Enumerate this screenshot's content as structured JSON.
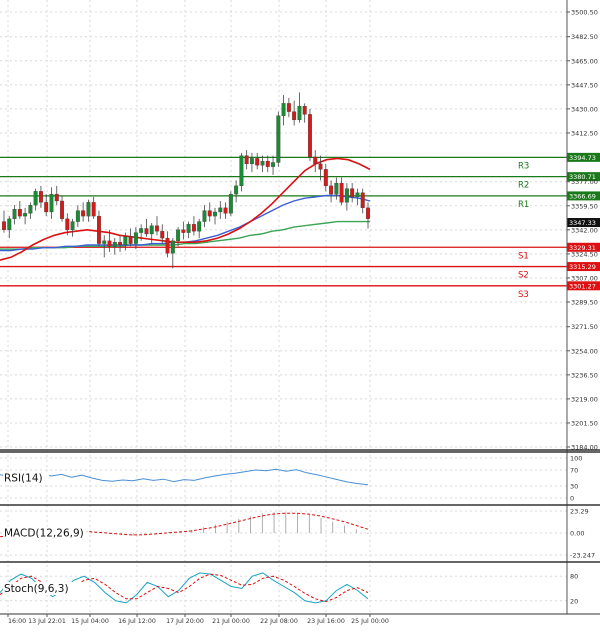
{
  "chart_data": {
    "type": "candlestick",
    "y_axis": {
      "min": 3184.0,
      "max": 3500.5,
      "ticks": [
        "3500.50",
        "3482.50",
        "3465.00",
        "3447.50",
        "3430.00",
        "3412.50",
        "3394.73",
        "3377.00",
        "3359.50",
        "3342.00",
        "3324.50",
        "3307.00",
        "3289.50",
        "3271.50",
        "3254.00",
        "3236.50",
        "3219.00",
        "3201.50",
        "3184.00"
      ]
    },
    "x_axis": {
      "labels": [
        "16:00",
        "13 Jul 22:01",
        "15 Jul 04:00",
        "16 Jul 12:00",
        "17 Jul 20:00",
        "21 Jul 00:00",
        "22 Jul 08:00",
        "23 Jul 16:00",
        "25 Jul 00:00"
      ]
    },
    "levels": [
      {
        "label": "R3",
        "value": 3394.73,
        "value_text": "3394.73",
        "color": "#1a7a1a"
      },
      {
        "label": "R2",
        "value": 3380.71,
        "value_text": "3380.71",
        "color": "#1a7a1a"
      },
      {
        "label": "R1",
        "value": 3366.69,
        "value_text": "3366.69",
        "color": "#1a7a1a"
      },
      {
        "label": "S1",
        "value": 3329.31,
        "value_text": "3329.31",
        "color": "#dd1111"
      },
      {
        "label": "S2",
        "value": 3315.29,
        "value_text": "3315.29",
        "color": "#dd1111"
      },
      {
        "label": "S3",
        "value": 3301.27,
        "value_text": "3301.27",
        "color": "#dd1111"
      }
    ],
    "last_price": {
      "value": 3347.33,
      "value_text": "3347.33"
    },
    "candles": [
      [
        3348,
        3356,
        3340,
        3342
      ],
      [
        3342,
        3352,
        3336,
        3350
      ],
      [
        3350,
        3360,
        3346,
        3357
      ],
      [
        3357,
        3363,
        3350,
        3352
      ],
      [
        3352,
        3358,
        3346,
        3354
      ],
      [
        3354,
        3362,
        3350,
        3360
      ],
      [
        3360,
        3372,
        3356,
        3370
      ],
      [
        3370,
        3374,
        3358,
        3362
      ],
      [
        3362,
        3368,
        3352,
        3355
      ],
      [
        3355,
        3373,
        3350,
        3368
      ],
      [
        3368,
        3374,
        3360,
        3363
      ],
      [
        3363,
        3367,
        3348,
        3350
      ],
      [
        3350,
        3354,
        3338,
        3342
      ],
      [
        3342,
        3350,
        3337,
        3348
      ],
      [
        3348,
        3360,
        3344,
        3356
      ],
      [
        3356,
        3362,
        3348,
        3352
      ],
      [
        3352,
        3364,
        3348,
        3362
      ],
      [
        3362,
        3366,
        3350,
        3352
      ],
      [
        3352,
        3356,
        3330,
        3332
      ],
      [
        3332,
        3338,
        3322,
        3334
      ],
      [
        3334,
        3342,
        3326,
        3330
      ],
      [
        3330,
        3336,
        3324,
        3333
      ],
      [
        3333,
        3338,
        3326,
        3331
      ],
      [
        3331,
        3340,
        3327,
        3337
      ],
      [
        3337,
        3343,
        3330,
        3332
      ],
      [
        3332,
        3344,
        3328,
        3340
      ],
      [
        3340,
        3346,
        3334,
        3343
      ],
      [
        3343,
        3350,
        3337,
        3339
      ],
      [
        3339,
        3347,
        3332,
        3345
      ],
      [
        3345,
        3352,
        3338,
        3341
      ],
      [
        3341,
        3346,
        3332,
        3336
      ],
      [
        3336,
        3341,
        3322,
        3325
      ],
      [
        3325,
        3336,
        3314,
        3334
      ],
      [
        3334,
        3344,
        3330,
        3342
      ],
      [
        3342,
        3348,
        3335,
        3340
      ],
      [
        3340,
        3348,
        3336,
        3346
      ],
      [
        3346,
        3352,
        3338,
        3341
      ],
      [
        3341,
        3350,
        3336,
        3348
      ],
      [
        3348,
        3360,
        3344,
        3356
      ],
      [
        3356,
        3362,
        3348,
        3352
      ],
      [
        3352,
        3358,
        3346,
        3355
      ],
      [
        3355,
        3363,
        3350,
        3358
      ],
      [
        3358,
        3362,
        3350,
        3354
      ],
      [
        3354,
        3370,
        3352,
        3368
      ],
      [
        3368,
        3378,
        3362,
        3374
      ],
      [
        3374,
        3398,
        3370,
        3396
      ],
      [
        3396,
        3400,
        3386,
        3390
      ],
      [
        3390,
        3398,
        3384,
        3394
      ],
      [
        3394,
        3398,
        3386,
        3389
      ],
      [
        3389,
        3396,
        3384,
        3392
      ],
      [
        3392,
        3396,
        3384,
        3388
      ],
      [
        3388,
        3396,
        3382,
        3391
      ],
      [
        3391,
        3428,
        3388,
        3425
      ],
      [
        3425,
        3440,
        3418,
        3434
      ],
      [
        3434,
        3438,
        3424,
        3428
      ],
      [
        3428,
        3436,
        3418,
        3422
      ],
      [
        3422,
        3442,
        3420,
        3432
      ],
      [
        3432,
        3434,
        3420,
        3426
      ],
      [
        3426,
        3430,
        3392,
        3395
      ],
      [
        3395,
        3400,
        3384,
        3390
      ],
      [
        3390,
        3396,
        3378,
        3386
      ],
      [
        3386,
        3390,
        3370,
        3374
      ],
      [
        3374,
        3378,
        3362,
        3368
      ],
      [
        3368,
        3380,
        3364,
        3376
      ],
      [
        3376,
        3380,
        3360,
        3362
      ],
      [
        3362,
        3376,
        3356,
        3372
      ],
      [
        3372,
        3376,
        3362,
        3366
      ],
      [
        3366,
        3372,
        3360,
        3369
      ],
      [
        3369,
        3372,
        3354,
        3358
      ],
      [
        3358,
        3362,
        3343,
        3350
      ]
    ],
    "ma": {
      "red": [
        3320,
        3322,
        3326,
        3331,
        3335,
        3338,
        3340,
        3341,
        3342,
        3341,
        3340,
        3338,
        3337,
        3336,
        3335,
        3334,
        3333,
        3333,
        3333,
        3334,
        3336,
        3339,
        3343,
        3348,
        3354,
        3361,
        3369,
        3377,
        3385,
        3390,
        3393,
        3394,
        3393,
        3390,
        3386
      ],
      "blue": [
        3327,
        3327,
        3328,
        3328,
        3329,
        3329,
        3330,
        3330,
        3331,
        3331,
        3331,
        3331,
        3331,
        3331,
        3332,
        3332,
        3333,
        3333,
        3334,
        3336,
        3338,
        3341,
        3344,
        3348,
        3352,
        3356,
        3360,
        3363,
        3365,
        3366,
        3367,
        3367,
        3366,
        3365,
        3363
      ],
      "green": [
        3328,
        3328,
        3328,
        3329,
        3329,
        3329,
        3329,
        3330,
        3330,
        3330,
        3330,
        3330,
        3331,
        3331,
        3331,
        3331,
        3331,
        3332,
        3332,
        3333,
        3334,
        3335,
        3336,
        3338,
        3339,
        3341,
        3342,
        3344,
        3345,
        3346,
        3347,
        3348,
        3348,
        3348,
        3348
      ]
    },
    "indicators": [
      {
        "name": "RSI(14)",
        "ticks": [
          "100",
          "70",
          "30",
          "0"
        ],
        "min": 0,
        "max": 100,
        "values": [
          58,
          54,
          62,
          56,
          61,
          55,
          59,
          52,
          57,
          50,
          44,
          42,
          45,
          43,
          48,
          44,
          47,
          41,
          46,
          44,
          50,
          55,
          59,
          62,
          66,
          70,
          68,
          72,
          67,
          71,
          63,
          58,
          52,
          46,
          40,
          36,
          33
        ],
        "color": "#4a8fd6"
      },
      {
        "name": "MACD(12,26,9)",
        "ticks": [
          "23.29",
          "0.00",
          "-23.247"
        ],
        "min": -23.247,
        "max": 23.29,
        "signal": [
          -4,
          -2,
          1,
          3,
          4,
          4,
          3,
          2,
          1,
          0,
          -1,
          -2,
          -2,
          -1,
          0,
          1,
          2,
          4,
          6,
          9,
          12,
          15,
          18,
          20,
          21,
          21,
          20,
          18,
          15,
          12,
          8,
          4
        ],
        "histogram": [
          -3,
          1,
          3,
          5,
          5,
          3,
          2,
          1,
          0,
          -1,
          -2,
          -3,
          -2,
          -1,
          1,
          2,
          3,
          6,
          9,
          12,
          15,
          18,
          21,
          22,
          22,
          21,
          19,
          16,
          12,
          8,
          4,
          -1
        ],
        "color": "#dd1111"
      },
      {
        "name": "Stoch(9,6,3)",
        "ticks": [
          "80",
          "20"
        ],
        "min": 0,
        "max": 100,
        "k": [
          40,
          70,
          85,
          75,
          50,
          30,
          45,
          70,
          80,
          65,
          40,
          20,
          15,
          35,
          65,
          55,
          30,
          45,
          75,
          88,
          85,
          70,
          55,
          50,
          80,
          88,
          70,
          55,
          40,
          20,
          15,
          20,
          45,
          60,
          45,
          25
        ],
        "d": [
          35,
          55,
          75,
          80,
          65,
          45,
          40,
          55,
          70,
          75,
          60,
          40,
          25,
          25,
          40,
          55,
          50,
          40,
          55,
          75,
          85,
          82,
          70,
          58,
          60,
          75,
          80,
          70,
          55,
          38,
          25,
          18,
          28,
          45,
          52,
          40
        ],
        "color_k": "#1aa3c8",
        "color_d": "#dd1111"
      }
    ]
  }
}
